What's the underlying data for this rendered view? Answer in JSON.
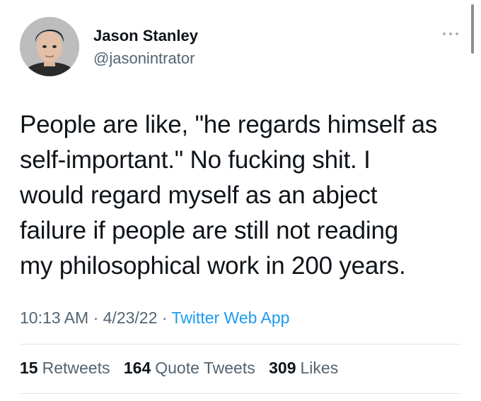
{
  "author": {
    "name": "Jason Stanley",
    "handle": "@jasonintrator"
  },
  "more_icon": "more-dots-icon",
  "tweet": {
    "lines": [
      "People are like, \"he regards himself as",
      "self-important.\" No fucking shit. I",
      "would regard myself as an abject",
      "failure if people are still not reading",
      "my philosophical work in 200 years."
    ]
  },
  "meta": {
    "time": "10:13 AM",
    "sep1": " · ",
    "date": "4/23/22",
    "sep2": " · ",
    "source": "Twitter Web App"
  },
  "stats": {
    "retweets_count": "15",
    "retweets_label": "Retweets",
    "quotes_count": "164",
    "quotes_label": "Quote Tweets",
    "likes_count": "309",
    "likes_label": "Likes"
  },
  "colors": {
    "text": "#0f1419",
    "secondary": "#536471",
    "link": "#1d9bf0",
    "divider": "#e1e6ea"
  }
}
